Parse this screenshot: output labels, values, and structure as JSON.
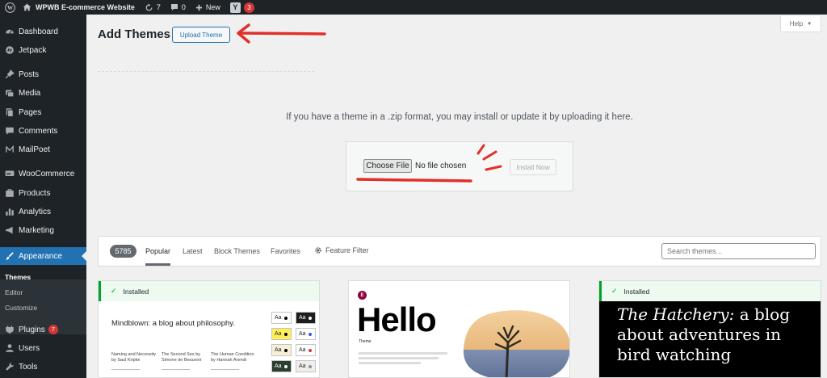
{
  "admin_bar": {
    "site_name": "WPWB E-commerce Website",
    "updates_count": "7",
    "comments_count": "0",
    "new_label": "New",
    "yoast_letter": "Y",
    "yoast_badge": "3"
  },
  "sidebar": {
    "items": [
      {
        "label": "Dashboard",
        "icon": "dashboard-icon"
      },
      {
        "label": "Jetpack",
        "icon": "jetpack-icon"
      },
      {
        "label": "Posts",
        "icon": "pin-icon"
      },
      {
        "label": "Media",
        "icon": "media-icon"
      },
      {
        "label": "Pages",
        "icon": "pages-icon"
      },
      {
        "label": "Comments",
        "icon": "comment-icon"
      },
      {
        "label": "MailPoet",
        "icon": "mailpoet-icon"
      },
      {
        "label": "WooCommerce",
        "icon": "woocommerce-icon"
      },
      {
        "label": "Products",
        "icon": "products-icon"
      },
      {
        "label": "Analytics",
        "icon": "analytics-icon"
      },
      {
        "label": "Marketing",
        "icon": "megaphone-icon"
      },
      {
        "label": "Appearance",
        "icon": "brush-icon"
      },
      {
        "label": "Plugins",
        "icon": "plugin-icon",
        "badge": "7"
      },
      {
        "label": "Users",
        "icon": "users-icon"
      },
      {
        "label": "Tools",
        "icon": "tools-icon"
      }
    ],
    "submenu": [
      "Themes",
      "Editor",
      "Customize"
    ]
  },
  "main": {
    "title": "Add Themes",
    "upload_button": "Upload Theme",
    "help": "Help",
    "upload_description": "If you have a theme in a .zip format, you may install or update it by uploading it here.",
    "choose_file": "Choose File",
    "no_file": "No file chosen",
    "install_now": "Install Now"
  },
  "filter_bar": {
    "count": "5785",
    "tabs": [
      "Popular",
      "Latest",
      "Block Themes",
      "Favorites"
    ],
    "feature_filter": "Feature Filter",
    "search_placeholder": "Search themes..."
  },
  "themes": {
    "installed_label": "Installed",
    "card1": {
      "title": "Mindblown: a blog about philosophy.",
      "col1_title": "Naming and Necessity",
      "col1_author": "by Saul Kripke",
      "col2_title": "The Second Sex by",
      "col2_author": "Simone de Beauvoir",
      "col3_title": "The Human Condition",
      "col3_author": "by Hannah Arendt",
      "swatch_text": "Aa"
    },
    "card2": {
      "logo_letter": "E",
      "word": "Hello",
      "sub": "Theme"
    },
    "card3": {
      "title_italic": "The Hatchery:",
      "title_rest": " a blog about adventures in bird watching"
    }
  },
  "colors": {
    "admin_dark": "#1d2327",
    "accent": "#2271b1",
    "installed_green": "#00a32a",
    "badge_red": "#d63638",
    "annotation_red": "#e0302a"
  }
}
